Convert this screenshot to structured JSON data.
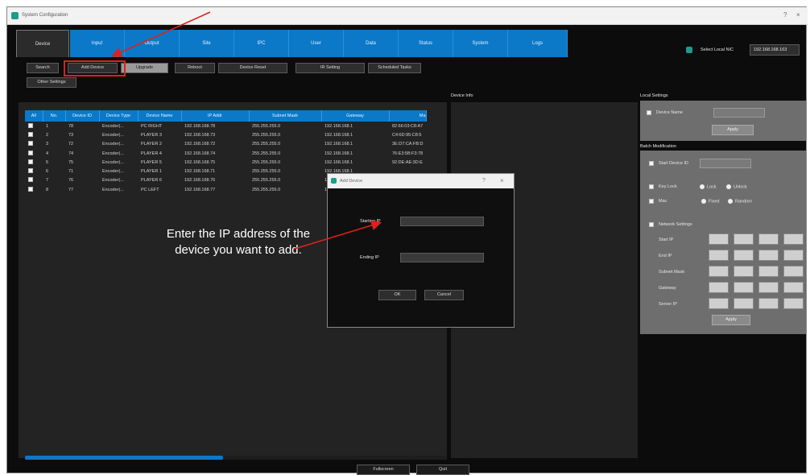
{
  "window": {
    "title": "System Configuration",
    "controls": [
      "?",
      "×"
    ]
  },
  "tabs": [
    "Device",
    "Input",
    "Output",
    "Site",
    "IPC",
    "User",
    "Data",
    "Status",
    "System",
    "Logs"
  ],
  "nic": {
    "label": "Select Local NIC",
    "value": "192.168.168.163"
  },
  "toolbar": [
    "Search",
    "Add Device",
    "Upgrade",
    "Reboot",
    "Device Reset",
    "IR Setting",
    "Scheduled Tasks"
  ],
  "toolbar2": [
    "Other Settings"
  ],
  "table": {
    "columns": [
      "All",
      "No.",
      "Device ID",
      "Device Type",
      "Device Name",
      "IP Addr",
      "Subnet Mask",
      "Gateway",
      "Ma"
    ],
    "rows": [
      [
        "1",
        "78",
        "Encoder(...",
        "PC RIGHT",
        "192.168.168.78",
        "255.255.255.0",
        "192.168.168.1",
        "82:66:03:C8:A7"
      ],
      [
        "2",
        "73",
        "Encoder(...",
        "PLAYER 3",
        "192.168.168.73",
        "255.255.255.0",
        "192.168.168.1",
        "C4:6D:95:C8:5"
      ],
      [
        "3",
        "72",
        "Encoder(...",
        "PLAYER 2",
        "192.168.168.72",
        "255.255.255.0",
        "192.168.168.1",
        "3E:D7:CA:FB:D"
      ],
      [
        "4",
        "74",
        "Encoder(...",
        "PLAYER 4",
        "192.168.168.74",
        "255.255.255.0",
        "192.168.168.1",
        "76:E3:5B:F3:78"
      ],
      [
        "5",
        "75",
        "Encoder(...",
        "PLAYER 5",
        "192.168.168.75",
        "255.255.255.0",
        "192.168.168.1",
        "92:DE:AE:3D:E"
      ],
      [
        "6",
        "71",
        "Encoder(...",
        "PLAYER 1",
        "192.168.168.71",
        "255.255.255.0",
        "192.168.168.1",
        ""
      ],
      [
        "7",
        "76",
        "Encoder(...",
        "PLAYER 6",
        "192.168.168.76",
        "255.255.255.0",
        "192.168.168.1",
        ""
      ],
      [
        "8",
        "77",
        "Encoder(...",
        "PC LEFT",
        "192.168.168.77",
        "255.255.255.0",
        "192.168.168.1",
        ""
      ]
    ]
  },
  "device_info": {
    "label": "Device Info"
  },
  "local_settings": {
    "title": "Local Settings",
    "device_name_label": "Device Name",
    "device_name_value": "",
    "apply": "Apply"
  },
  "batch": {
    "title": "Batch Modification",
    "start_id_label": "Start Device ID",
    "key_lock_label": "Key Lock",
    "lock": "Lock",
    "unlock": "Unlock",
    "mac_label": "Mac",
    "fixed": "Fixed",
    "random": "Random",
    "network_label": "Network Settings",
    "rows": [
      "Start IP",
      "End IP",
      "Subnet Mask",
      "Gateway",
      "Server IP"
    ],
    "apply": "Apply"
  },
  "bottom": {
    "fullscreen": "Fullscreen",
    "quit": "Quit"
  },
  "dialog": {
    "title": "Add Device",
    "controls": [
      "?",
      "×"
    ],
    "starting_ip_label": "Starting IP",
    "starting_ip_value": "",
    "ending_ip_label": "Ending IP",
    "ending_ip_value": "",
    "ok": "OK",
    "cancel": "Cancel"
  },
  "annotation": {
    "text": "Enter the IP address of the device you want to add."
  },
  "colors": {
    "accent": "#0b79c8",
    "highlight": "#e0201b",
    "background": "#0c0c0c"
  }
}
